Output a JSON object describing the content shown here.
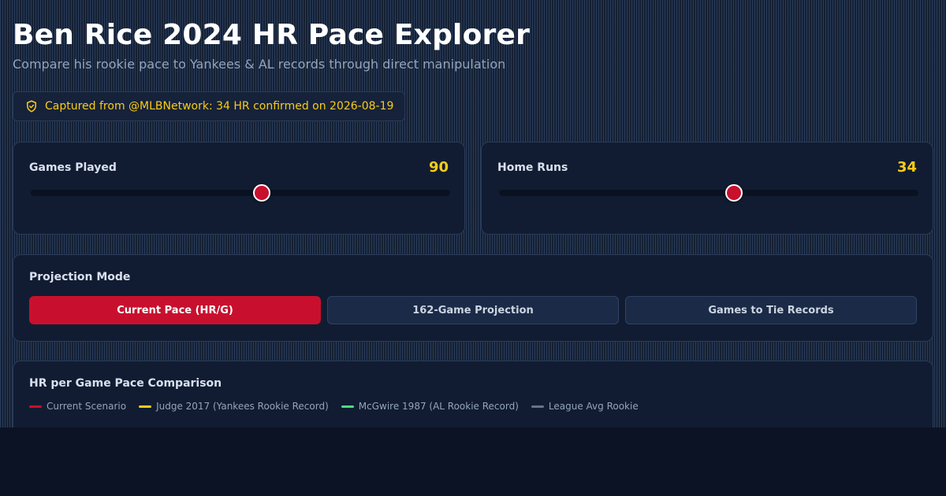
{
  "header": {
    "title": "Ben Rice 2024 HR Pace Explorer",
    "subtitle": "Compare his rookie pace to Yankees & AL records through direct manipulation"
  },
  "badge": {
    "icon": "shield-check-icon",
    "text": "Captured from @MLBNetwork: 34 HR confirmed on 2026-08-19"
  },
  "sliders": {
    "games": {
      "label": "Games Played",
      "value": "90",
      "fraction": 0.55
    },
    "homeruns": {
      "label": "Home Runs",
      "value": "34",
      "fraction": 0.56
    }
  },
  "projection": {
    "label": "Projection Mode",
    "modes": [
      {
        "label": "Current Pace (HR/G)",
        "active": true
      },
      {
        "label": "162-Game Projection",
        "active": false
      },
      {
        "label": "Games to Tie Records",
        "active": false
      }
    ]
  },
  "chart": {
    "title": "HR per Game Pace Comparison",
    "legend": [
      {
        "label": "Current Scenario",
        "color": "#c8102e"
      },
      {
        "label": "Judge 2017 (Yankees Rookie Record)",
        "color": "#facc15"
      },
      {
        "label": "McGwire 1987 (AL Rookie Record)",
        "color": "#4ade80"
      },
      {
        "label": "League Avg Rookie",
        "color": "#64748b"
      }
    ]
  },
  "colors": {
    "accent": "#c8102e",
    "highlight": "#facc15"
  }
}
